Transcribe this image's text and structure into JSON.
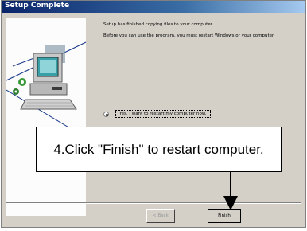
{
  "window": {
    "title": "Setup Complete"
  },
  "messages": [
    "Setup has finished copying files to your computer.",
    "Before you can use the program, you must restart Windows or your computer."
  ],
  "restart_option": {
    "label": "Yes, I want to restart my computer now.",
    "selected": true
  },
  "buttons": {
    "back": "< Back",
    "finish": "Finish"
  },
  "callout": {
    "text": "4.Click \"Finish\" to restart computer."
  },
  "icons": {
    "art": "computer-setup-icon",
    "pointer": "arrow-down-icon"
  },
  "colors": {
    "titlebar": "#0a246a",
    "dialog_bg": "#d4d0c8",
    "accent_green": "#3a9a3a"
  }
}
